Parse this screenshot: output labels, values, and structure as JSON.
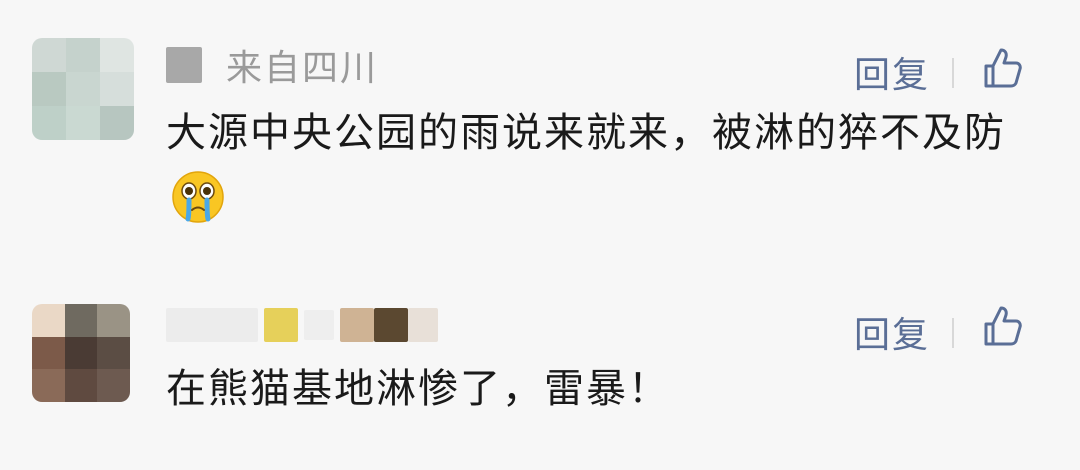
{
  "comments": [
    {
      "location": "来自四川",
      "reply_label": "回复",
      "text": "大源中央公园的雨说来就来，被淋的猝不及防",
      "emoji": "crying-face-emoji"
    },
    {
      "reply_label": "回复",
      "text": "在熊猫基地淋惨了，雷暴！"
    }
  ],
  "icons": {
    "like": "thumbs-up-icon"
  },
  "colors": {
    "background": "#f7f7f7",
    "reply_link": "#5a6e96",
    "text": "#1a1a1a",
    "meta": "#9a9a9a"
  }
}
